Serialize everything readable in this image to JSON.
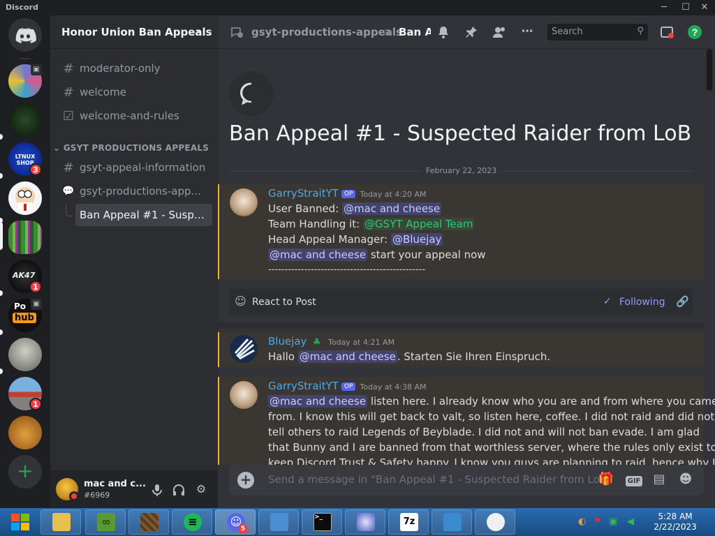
{
  "window": {
    "brand": "Discord"
  },
  "servers": {
    "items": [
      {
        "name": "discord-home",
        "badge": ""
      },
      {
        "name": "server-1",
        "badge": ""
      },
      {
        "name": "server-2",
        "badge": ""
      },
      {
        "name": "server-3",
        "badge": "3"
      },
      {
        "name": "server-4",
        "badge": ""
      },
      {
        "name": "server-5",
        "badge": ""
      },
      {
        "name": "server-6",
        "badge": "1"
      },
      {
        "name": "server-7",
        "badge": ""
      },
      {
        "name": "server-8",
        "badge": ""
      },
      {
        "name": "server-9",
        "badge": "1"
      },
      {
        "name": "server-10",
        "badge": ""
      }
    ],
    "add_symbol": "+",
    "server3_text": "LTNUX SHOP",
    "server6_text": "AK47",
    "server7_text_top": "Po",
    "server7_text_hub": "hub"
  },
  "guild": {
    "name": "Honor Union Ban Appeals",
    "chevron": "⌄"
  },
  "channels": {
    "items": [
      {
        "icon": "#",
        "label": "moderator-only"
      },
      {
        "icon": "#",
        "label": "welcome"
      },
      {
        "icon": "☑",
        "label": "welcome-and-rules"
      }
    ],
    "category": "GSYT PRODUCTIONS APPEALS",
    "category_chevron": "⌄",
    "cat_items": [
      {
        "icon": "#",
        "label": "gsyt-appeal-information"
      },
      {
        "icon": "💬",
        "label": "gsyt-productions-app..."
      }
    ],
    "thread": {
      "label": "Ban Appeal #1 - Suspect..."
    }
  },
  "user": {
    "name": "mac and c...",
    "tag": "#6969"
  },
  "topbar": {
    "parent": "gsyt-productions-appeals",
    "separator": ">",
    "thread": "Ban A",
    "search_placeholder": "Search"
  },
  "post": {
    "title": "Ban Appeal #1 - Suspected Raider from LoB",
    "date_divider": "February 22, 2023",
    "react_label": "React to Post",
    "following_label": "Following"
  },
  "messages": [
    {
      "author": "GarryStraitYT",
      "op": "OP",
      "time": "Today at 4:20 AM",
      "line1_prefix": "User Banned: ",
      "line1_mention": "@mac and cheese",
      "line2_prefix": "Team Handling it: ",
      "line2_role": "@GSYT Appeal Team",
      "line3_prefix": "Head Appeal Manager: ",
      "line3_mention": "@Bluejay",
      "line4_mention": "@mac and cheese",
      "line4_suffix": " start your appeal now",
      "line5": "------------------------------------------------"
    },
    {
      "author": "Bluejay",
      "time": "Today at 4:21 AM",
      "prefix": "Hallo ",
      "mention": "@mac and cheese",
      "suffix": ". Starten Sie Ihren Einspruch."
    },
    {
      "author": "GarryStraitYT",
      "op": "OP",
      "time": "Today at 4:38 AM",
      "mention": "@mac and cheese",
      "line1": " listen here. I already know who you are and from where you came",
      "line2": "from. I know this will get back to valt, so listen here, coffee. I did not raid and did not",
      "line3": "tell others to raid Legends of Beyblade. I did not and will not ban evade. I am glad",
      "line4": "that Bunny and I are banned from that worthless server, where the rules only exist to",
      "line5": "keep Discord Trust & Safety happy. I know you guys are planning to raid, hence why I"
    }
  ],
  "composer": {
    "placeholder": "Send a message in \"Ban Appeal #1 - Suspected Raider from LoB\"",
    "gif": "GIF"
  },
  "taskbar": {
    "apps": [
      "file-explorer",
      "minecraft-launcher",
      "minecraft",
      "spotify",
      "discord",
      "control-panel",
      "terminal",
      "beyblade",
      "7zip",
      "app-10",
      "app-11"
    ],
    "discord_badge": "5",
    "sevenzip": "7z",
    "time": "5:28 AM",
    "date": "2/22/2023"
  }
}
